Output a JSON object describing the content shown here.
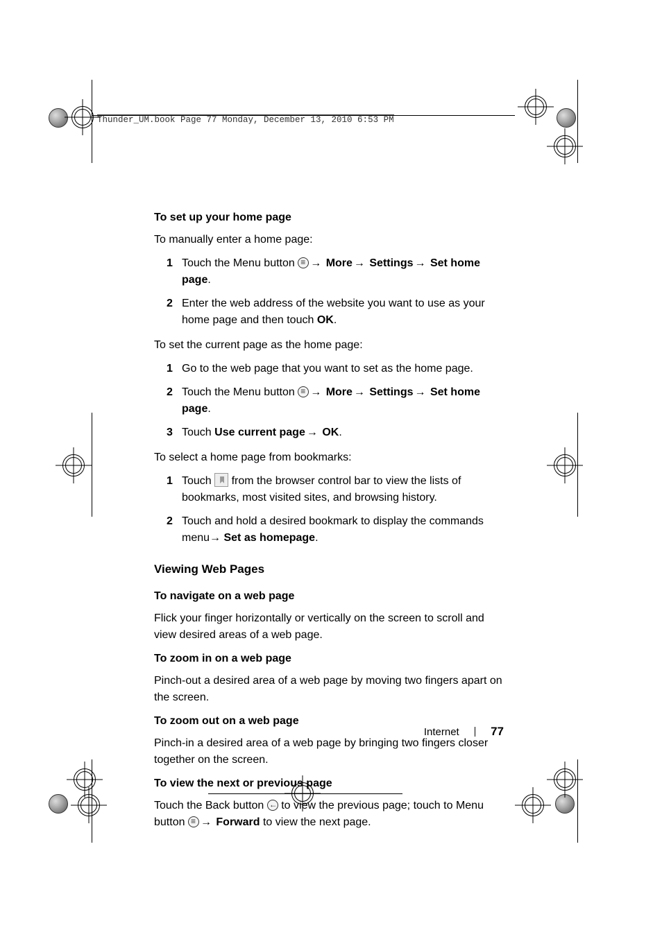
{
  "header_line": "Thunder_UM.book  Page 77  Monday, December 13, 2010  6:53 PM",
  "sections": {
    "setup_home": {
      "title": "To set up your home page",
      "intro": "To manually enter a home page:",
      "steps": [
        {
          "num": "1",
          "pre": "Touch the Menu button ",
          "post": "→ ",
          "bold_parts": [
            "More",
            "Settings",
            "Set home page"
          ],
          "trail": "."
        },
        {
          "num": "2",
          "text_a": "Enter the web address of the website you want to use as your home page and then touch ",
          "bold": "OK",
          "text_b": "."
        }
      ],
      "intro2": "To set the current page as the home page:",
      "steps2": [
        {
          "num": "1",
          "text": "Go to the web page that you want to set as the home page."
        },
        {
          "num": "2",
          "pre": "Touch the Menu button ",
          "post": "→ ",
          "bold_parts": [
            "More",
            "Settings",
            "Set home page"
          ],
          "trail": "."
        },
        {
          "num": "3",
          "pre": "Touch ",
          "bold_a": "Use current page",
          "mid": "→ ",
          "bold_b": "OK",
          "trail": "."
        }
      ],
      "intro3": "To select a home page from bookmarks:",
      "steps3": [
        {
          "num": "1",
          "pre": "Touch ",
          "post": " from the browser control bar to view the lists of bookmarks, most visited sites, and browsing history."
        },
        {
          "num": "2",
          "pre": "Touch and hold a desired bookmark to display the commands menu→ ",
          "bold": "Set as homepage",
          "trail": "."
        }
      ]
    },
    "viewing": {
      "title": "Viewing Web Pages",
      "nav": {
        "title": "To navigate on a web page",
        "body": "Flick your finger horizontally or vertically on the screen to scroll and view desired areas of a web page."
      },
      "zoom_in": {
        "title": "To zoom in on a web page",
        "body": "Pinch-out a desired area of a web page by moving two fingers apart on the screen."
      },
      "zoom_out": {
        "title": "To zoom out on a web page",
        "body": "Pinch-in a desired area of a web page by bringing two fingers closer together on the screen."
      },
      "next_prev": {
        "title": "To view the next or previous page",
        "body_a": "Touch the Back button ",
        "body_b": " to view the previous page; touch to Menu button ",
        "body_c": "→ ",
        "bold": "Forward",
        "body_d": " to view the next page."
      }
    }
  },
  "footer": {
    "section": "Internet",
    "page": "77"
  }
}
